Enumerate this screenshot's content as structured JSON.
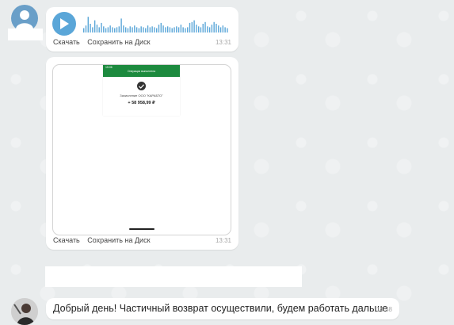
{
  "messages": {
    "voice": {
      "download_label": "Скачать",
      "save_label": "Сохранить на Диск",
      "time": "13:31",
      "waveform_levels": [
        0.25,
        0.4,
        0.9,
        0.5,
        0.3,
        0.7,
        0.45,
        0.3,
        0.55,
        0.35,
        0.25,
        0.3,
        0.4,
        0.3,
        0.25,
        0.3,
        0.35,
        0.8,
        0.4,
        0.3,
        0.25,
        0.35,
        0.3,
        0.4,
        0.3,
        0.25,
        0.35,
        0.3,
        0.25,
        0.4,
        0.3,
        0.35,
        0.3,
        0.25,
        0.45,
        0.55,
        0.4,
        0.3,
        0.35,
        0.3,
        0.25,
        0.3,
        0.35,
        0.3,
        0.45,
        0.3,
        0.25,
        0.3,
        0.55,
        0.6,
        0.7,
        0.45,
        0.35,
        0.3,
        0.5,
        0.6,
        0.35,
        0.3,
        0.45,
        0.6,
        0.5,
        0.4,
        0.3,
        0.4,
        0.3,
        0.25
      ],
      "waveform_color": "#5aa6d8"
    },
    "image": {
      "receipt": {
        "status_time": "15:06",
        "title": "Операция выполнена",
        "line": "Зачисление ООО \"КАРАБТО\"",
        "amount": "+ 58 958,99 ₽"
      },
      "download_label": "Скачать",
      "save_label": "Сохранить на Диск",
      "time": "13:31"
    },
    "text": {
      "body": "Добрый день! Частичный возврат осуществили, будем работать дальше",
      "time": "14:58"
    }
  },
  "colors": {
    "accent": "#5aa6d8",
    "bank_green": "#1c8a3e"
  }
}
